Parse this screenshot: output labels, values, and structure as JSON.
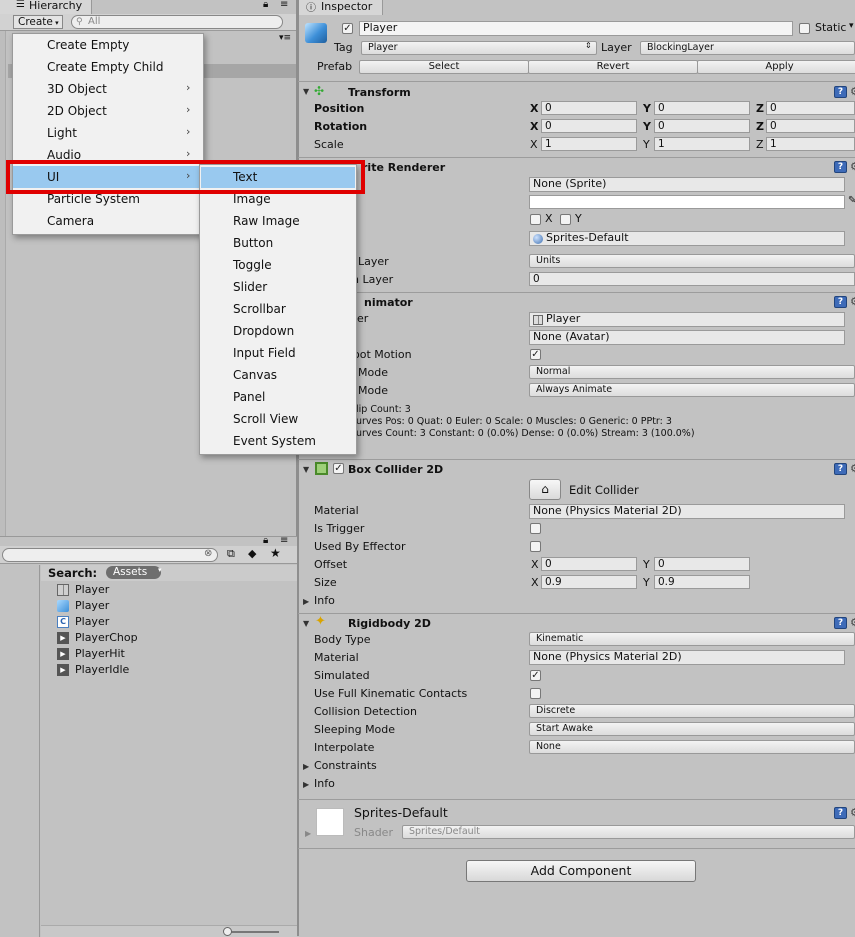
{
  "hierarchy": {
    "title": "Hierarchy",
    "create_label": "Create",
    "search_placeholder": "All"
  },
  "create_menu": {
    "items": [
      "Create Empty",
      "Create Empty Child",
      "3D Object",
      "2D Object",
      "Light",
      "Audio",
      "UI",
      "Particle System",
      "Camera"
    ],
    "ui_submenu": [
      "Text",
      "Image",
      "Raw Image",
      "Button",
      "Toggle",
      "Slider",
      "Scrollbar",
      "Dropdown",
      "Input Field",
      "Canvas",
      "Panel",
      "Scroll View",
      "Event System"
    ]
  },
  "project": {
    "search_label": "Search:",
    "assets_chip": "Assets",
    "items": [
      "Player",
      "Player",
      "Player",
      "PlayerChop",
      "PlayerHit",
      "PlayerIdle"
    ]
  },
  "inspector": {
    "title": "Inspector",
    "object_name": "Player",
    "static_label": "Static",
    "tag_label": "Tag",
    "tag_value": "Player",
    "layer_label": "Layer",
    "layer_value": "BlockingLayer",
    "prefab_label": "Prefab",
    "select_label": "Select",
    "revert_label": "Revert",
    "apply_label": "Apply",
    "axes": {
      "x": "X",
      "y": "Y",
      "z": "Z"
    },
    "transform": {
      "title": "Transform",
      "position_label": "Position",
      "rotation_label": "Rotation",
      "scale_label": "Scale",
      "position": [
        "0",
        "0",
        "0"
      ],
      "rotation": [
        "0",
        "0",
        "0"
      ],
      "scale": [
        "1",
        "1",
        "1"
      ]
    },
    "sprite_renderer": {
      "title_visible": "rite Renderer",
      "sprite_value": "None (Sprite)",
      "flip_x": "X",
      "flip_y": "Y",
      "material_value": "Sprites-Default",
      "sorting_layer_label": "Layer",
      "sorting_layer_value": "Units",
      "order_label": "n Layer",
      "order_value": "0"
    },
    "animator": {
      "title_visible": "nimator",
      "controller_label": "er",
      "controller_value": "Player",
      "avatar_value": "None (Avatar)",
      "root_motion_label": "oot Motion",
      "update_mode_label": "Mode",
      "update_mode_value": "Normal",
      "culling_mode_label": "Mode",
      "culling_mode_value": "Always Animate",
      "info_line1": "lip Count: 3",
      "info_line2": "urves Pos: 0 Quat: 0 Euler: 0 Scale: 0 Muscles: 0 Generic: 0 PPtr: 3",
      "info_line3": "urves Count: 3 Constant: 0 (0.0%) Dense: 0 (0.0%) Stream: 3 (100.0%)"
    },
    "box_collider": {
      "title": "Box Collider 2D",
      "edit_collider_label": "Edit Collider",
      "material_label": "Material",
      "material_value": "None (Physics Material 2D)",
      "is_trigger_label": "Is Trigger",
      "used_by_effector_label": "Used By Effector",
      "offset_label": "Offset",
      "offset": [
        "0",
        "0"
      ],
      "size_label": "Size",
      "size": [
        "0.9",
        "0.9"
      ],
      "info_label": "Info"
    },
    "rigidbody": {
      "title": "Rigidbody 2D",
      "body_type_label": "Body Type",
      "body_type_value": "Kinematic",
      "material_label": "Material",
      "material_value": "None (Physics Material 2D)",
      "simulated_label": "Simulated",
      "full_kinematic_label": "Use Full Kinematic Contacts",
      "collision_label": "Collision Detection",
      "collision_value": "Discrete",
      "sleeping_label": "Sleeping Mode",
      "sleeping_value": "Start Awake",
      "interpolate_label": "Interpolate",
      "interpolate_value": "None",
      "constraints_label": "Constraints",
      "info_label": "Info"
    },
    "material": {
      "name": "Sprites-Default",
      "shader_label": "Shader",
      "shader_value": "Sprites/Default"
    },
    "add_component_label": "Add Component"
  },
  "colors": {
    "menu_highlight": "#99c9ef",
    "red_outline": "#e00000",
    "panel_bg": "#c2c2c2"
  }
}
